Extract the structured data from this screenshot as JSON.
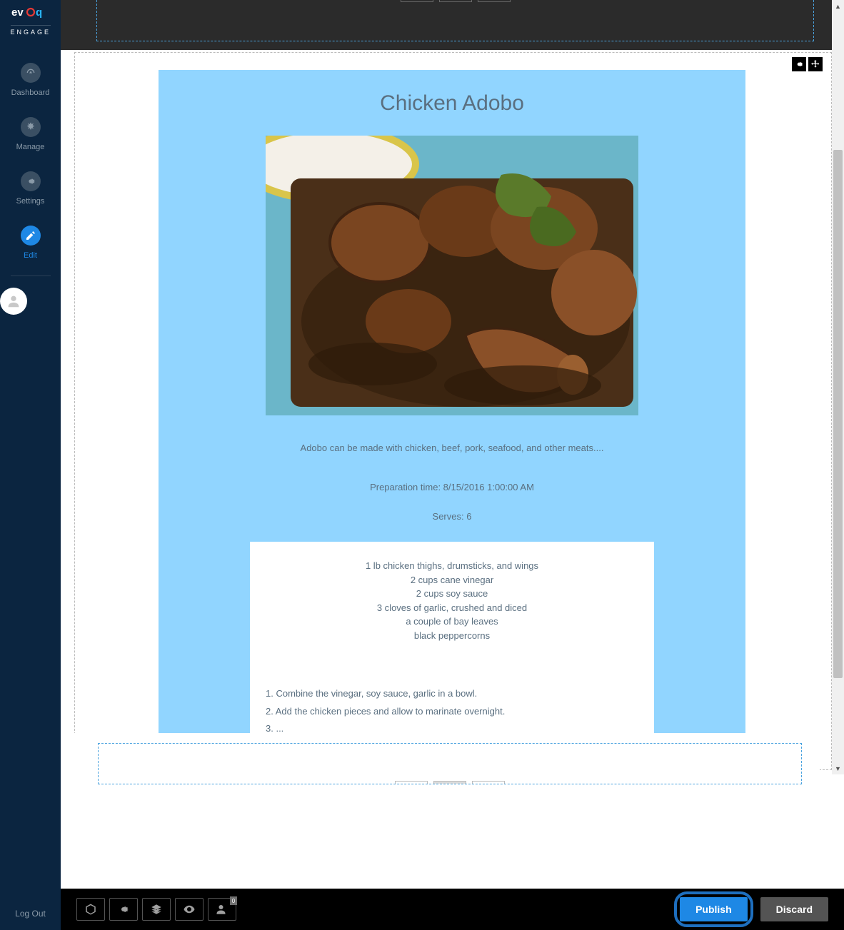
{
  "brand": {
    "name": "evoq",
    "sub": "ENGAGE"
  },
  "sidebar": {
    "items": [
      {
        "label": "Dashboard",
        "icon": "gauge-icon"
      },
      {
        "label": "Manage",
        "icon": "tools-icon"
      },
      {
        "label": "Settings",
        "icon": "gear-icon"
      },
      {
        "label": "Edit",
        "icon": "pencil-icon"
      }
    ],
    "logout": "Log Out"
  },
  "recipe": {
    "title": "Chicken Adobo",
    "description": "Adobo can be made with chicken, beef, pork, seafood, and other meats....",
    "prep_label": "Preparation time: 8/15/2016 1:00:00 AM",
    "serves_label": "Serves: 6",
    "ingredients": [
      "1 lb chicken thighs, drumsticks, and wings",
      "2 cups cane vinegar",
      "2 cups soy sauce",
      "3 cloves of garlic, crushed and diced",
      "a couple of bay leaves",
      "black peppercorns"
    ],
    "instructions": [
      "1. Combine the vinegar, soy sauce, garlic in a bowl.",
      "2. Add the chicken pieces and allow to marinate overnight.",
      "3. ..."
    ]
  },
  "toolbar": {
    "publish": "Publish",
    "discard": "Discard",
    "user_badge": "0"
  }
}
